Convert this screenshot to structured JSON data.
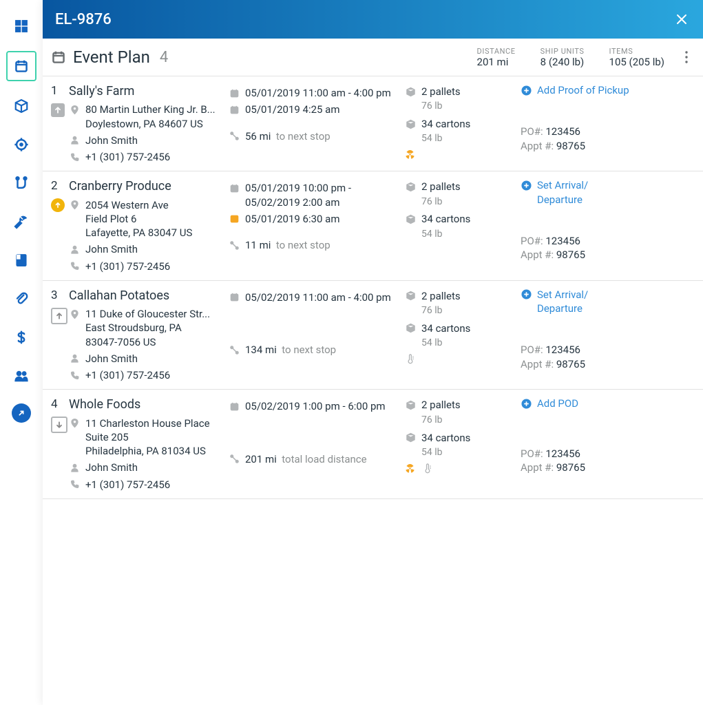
{
  "window": {
    "title": "EL-9876"
  },
  "header": {
    "title": "Event Plan",
    "count": "4",
    "stats": {
      "distance": {
        "label": "DISTANCE",
        "value": "201 mi"
      },
      "ship_units": {
        "label": "SHIP UNITS",
        "value": "8 (240 lb)"
      },
      "items": {
        "label": "ITEMS",
        "value": "105 (205 lb)"
      }
    }
  },
  "sidebar": {
    "items": [
      {
        "name": "dashboard-icon"
      },
      {
        "name": "calendar-icon",
        "active": true
      },
      {
        "name": "box-icon"
      },
      {
        "name": "target-icon"
      },
      {
        "name": "route-icon"
      },
      {
        "name": "wrench-icon"
      },
      {
        "name": "book-icon"
      },
      {
        "name": "paperclip-icon"
      },
      {
        "name": "dollar-icon"
      },
      {
        "name": "people-icon"
      },
      {
        "name": "collapse-icon"
      }
    ]
  },
  "stops": [
    {
      "idx": "1",
      "badge": {
        "type": "square",
        "dir": "up"
      },
      "name": "Sally's Farm",
      "address_line1": "80 Martin Luther King Jr. B...",
      "address_line2": "Doylestown, PA 84607 US",
      "contact": "John Smith",
      "phone": "+1 (301) 757-2456",
      "window": "05/01/2019 11:00 am - 4:00 pm",
      "eta": "05/01/2019 4:25 am",
      "eta_late": false,
      "distance_value": "56 mi",
      "distance_label": "to next stop",
      "pallets": "2 pallets",
      "pallets_wt": "76 lb",
      "cartons": "34 cartons",
      "cartons_wt": "54 lb",
      "hazmat": true,
      "therm": false,
      "action": "Add Proof of Pickup",
      "po_label": "PO#: ",
      "po": "123456",
      "appt_label": "Appt #: ",
      "appt": "98765"
    },
    {
      "idx": "2",
      "badge": {
        "type": "circle",
        "dir": "up"
      },
      "name": "Cranberry Produce",
      "address_line1": "2054 Western Ave",
      "address_line2": "Field Plot 6",
      "address_line3": "Lafayette, PA 83047 US",
      "contact": "John Smith",
      "phone": "+1 (301) 757-2456",
      "window": "05/01/2019 10:00 pm - 05/02/2019 2:00 am",
      "eta": "05/01/2019 6:30 am",
      "eta_late": true,
      "distance_value": "11 mi",
      "distance_label": "to next stop",
      "pallets": "2 pallets",
      "pallets_wt": "76 lb",
      "cartons": "34 cartons",
      "cartons_wt": "54 lb",
      "hazmat": false,
      "therm": false,
      "action": "Set Arrival/\nDeparture",
      "po_label": "PO#: ",
      "po": "123456",
      "appt_label": "Appt #: ",
      "appt": "98765"
    },
    {
      "idx": "3",
      "badge": {
        "type": "outline",
        "dir": "up"
      },
      "name": "Callahan Potatoes",
      "address_line1": "11 Duke of Gloucester Str...",
      "address_line2": "East Stroudsburg, PA",
      "address_line3": "83047-7056 US",
      "contact": "John Smith",
      "phone": "+1 (301) 757-2456",
      "window": "05/02/2019 11:00 am - 4:00 pm",
      "eta": "",
      "distance_value": "134 mi",
      "distance_label": "to next stop",
      "pallets": "2 pallets",
      "pallets_wt": "76 lb",
      "cartons": "34 cartons",
      "cartons_wt": "54 lb",
      "hazmat": false,
      "therm": true,
      "action": "Set Arrival/\nDeparture",
      "po_label": "PO#: ",
      "po": "123456",
      "appt_label": "Appt #: ",
      "appt": "98765"
    },
    {
      "idx": "4",
      "badge": {
        "type": "outline",
        "dir": "down"
      },
      "name": "Whole Foods",
      "address_line1": "11 Charleston House Place",
      "address_line2": "Suite 205",
      "address_line3": "Philadelphia, PA 81034 US",
      "contact": "John Smith",
      "phone": "+1 (301) 757-2456",
      "window": "05/02/2019 1:00 pm - 6:00 pm",
      "eta": "",
      "distance_value": "201 mi",
      "distance_label": "total load distance",
      "pallets": "2 pallets",
      "pallets_wt": "76 lb",
      "cartons": "34 cartons",
      "cartons_wt": "54 lb",
      "hazmat": true,
      "therm": true,
      "action": "Add POD",
      "po_label": "PO#: ",
      "po": "123456",
      "appt_label": "Appt #: ",
      "appt": "98765"
    }
  ]
}
